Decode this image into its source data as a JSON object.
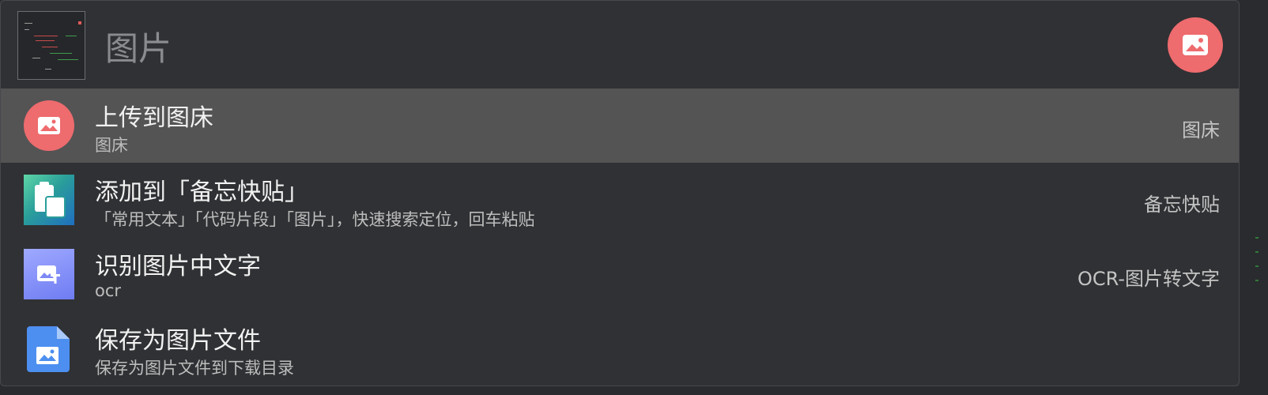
{
  "search": {
    "value": "图片",
    "placeholder": ""
  },
  "header": {
    "thumbnail": "screenshot-thumbnail",
    "plugin_icon": "image-icon",
    "plugin_color": "#ee6b6e"
  },
  "results": [
    {
      "title": "上传到图床",
      "desc": "图床",
      "source": "图床",
      "icon": "image-upload-icon",
      "selected": true
    },
    {
      "title": "添加到「备忘快贴」",
      "desc": "「常用文本」「代码片段」「图片」，快速搜索定位，回车粘贴",
      "source": "备忘快贴",
      "icon": "clipboard-icon",
      "selected": false
    },
    {
      "title": "识别图片中文字",
      "desc": "ocr",
      "source": "OCR-图片转文字",
      "icon": "ocr-image-icon",
      "selected": false
    },
    {
      "title": "保存为图片文件",
      "desc": "保存为图片文件到下载目录",
      "source": "",
      "icon": "image-file-icon",
      "selected": false
    }
  ],
  "colors": {
    "background": "#303134",
    "selected_row": "#545454",
    "accent_red": "#ee6b6e"
  }
}
